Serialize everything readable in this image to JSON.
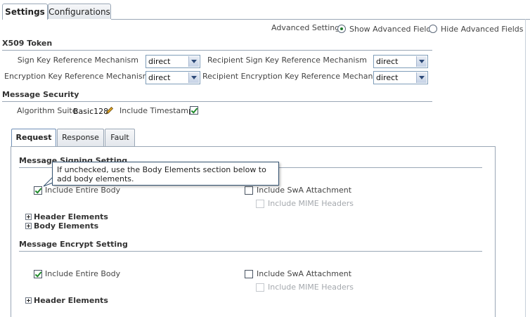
{
  "tabs": {
    "settings": "Settings",
    "configurations": "Configurations"
  },
  "advanced": {
    "label": "Advanced Setting",
    "show": "Show Advanced Fields",
    "hide": "Hide Advanced Fields",
    "selected": "show"
  },
  "x509": {
    "title": "X509 Token",
    "sign_key_label": "Sign Key Reference Mechanism",
    "sign_key_value": "direct",
    "recipient_sign_key_label": "Recipient Sign Key Reference Mechanism",
    "recipient_sign_key_value": "direct",
    "enc_key_label": "Encryption Key Reference Mechanism",
    "enc_key_value": "direct",
    "recipient_enc_key_label": "Recipient Encryption Key Reference Mechanism",
    "recipient_enc_key_value": "direct"
  },
  "message_security": {
    "title": "Message Security",
    "algorithm_label": "Algorithm Suite",
    "algorithm_value": "Basic128",
    "timestamp_label": "Include Timestamp",
    "timestamp_checked": true
  },
  "subtabs": {
    "request": "Request",
    "response": "Response",
    "fault": "Fault"
  },
  "signing": {
    "title": "Message Signing Setting",
    "include_body_label": "Include Entire Body",
    "include_body_checked": true,
    "swa_label": "Include SwA Attachment",
    "swa_checked": false,
    "mime_label": "Include MIME Headers",
    "mime_enabled": false,
    "header_elements": "Header Elements",
    "body_elements": "Body Elements"
  },
  "tooltip": {
    "text": "If unchecked, use the Body Elements section below to add body elements."
  },
  "encrypt": {
    "title": "Message Encrypt Setting",
    "include_body_label": "Include Entire Body",
    "include_body_checked": true,
    "swa_label": "Include SwA Attachment",
    "swa_checked": false,
    "mime_label": "Include MIME Headers",
    "mime_enabled": false,
    "header_elements": "Header Elements"
  },
  "colors": {
    "tab_border": "#9aa7b6",
    "check_green": "#1f8a2a",
    "select_border": "#7f9db9",
    "pencil": "#c98a1a"
  }
}
